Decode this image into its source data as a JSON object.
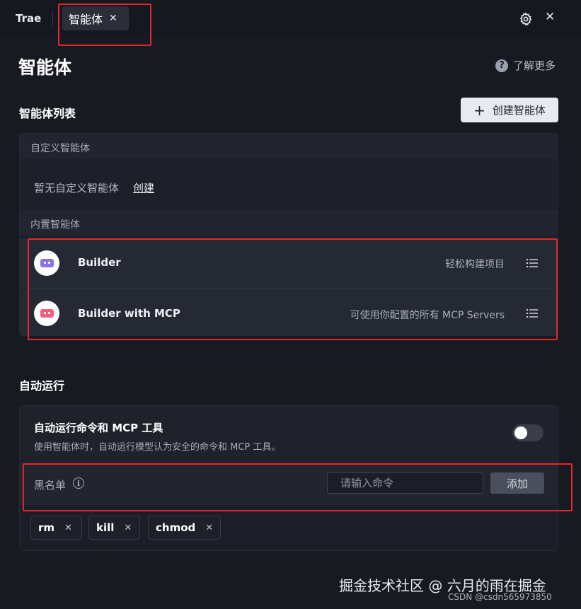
{
  "titlebar": {
    "app_name": "Trae",
    "tab_label": "智能体",
    "close_glyph": "✕",
    "icons": [
      "gear-icon",
      "close-icon"
    ]
  },
  "header": {
    "title": "智能体",
    "learn_more": "了解更多",
    "help_glyph": "?"
  },
  "agents": {
    "section_title": "智能体列表",
    "create_button": "创建智能体",
    "create_plus": "+",
    "custom_heading": "自定义智能体",
    "empty_text": "暂无自定义智能体",
    "empty_link": "创建",
    "builtin_heading": "内置智能体",
    "items": [
      {
        "name": "Builder",
        "description": "轻松构建项目",
        "avatar_color": "#8b72e8"
      },
      {
        "name": "Builder with MCP",
        "description": "可使用你配置的所有 MCP Servers",
        "avatar_color": "#f0607e"
      }
    ]
  },
  "auto_run": {
    "section_title": "自动运行",
    "toggle_title": "自动运行命令和 MCP 工具",
    "toggle_desc": "使用智能体时，自动运行模型认为安全的命令和 MCP 工具。",
    "toggle_on": false,
    "blacklist_label": "黑名单",
    "info_glyph": "i",
    "input_placeholder": "请输入命令",
    "add_button": "添加",
    "chips": [
      "rm",
      "kill",
      "chmod"
    ],
    "chip_remove_glyph": "✕"
  },
  "watermark": {
    "line1": "掘金技术社区 @ 六月的雨在掘金",
    "line2": "CSDN @csdn565973850"
  },
  "colors": {
    "background": "#181a22",
    "highlight": "#e0282a",
    "button_light": "#e8eaef"
  }
}
